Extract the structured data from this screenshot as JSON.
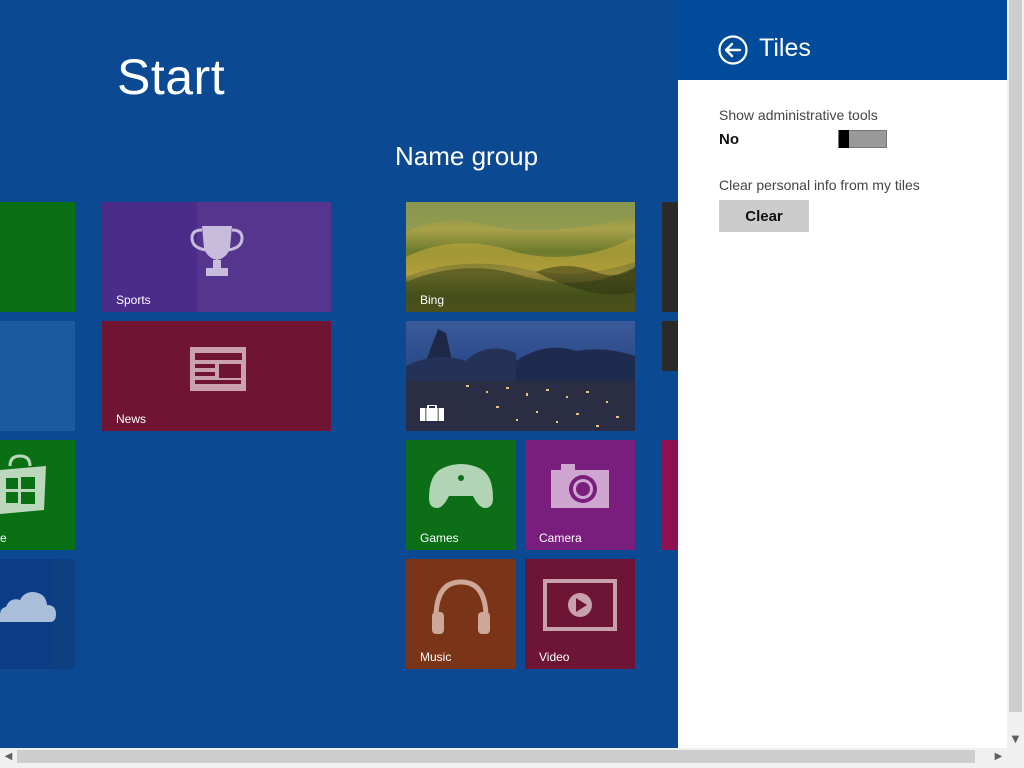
{
  "start": {
    "title": "Start",
    "group_name": "Name group",
    "tiles": {
      "sports": "Sports",
      "news": "News",
      "bing": "Bing",
      "games": "Games",
      "camera": "Camera",
      "music": "Music",
      "video": "Video",
      "store_partial": "e"
    }
  },
  "pane": {
    "title": "Tiles",
    "admin_tools_label": "Show administrative tools",
    "admin_tools_state": "No",
    "clear_info_label": "Clear personal info from my tiles",
    "clear_button": "Clear"
  },
  "colors": {
    "start_bg": "#0b4a92",
    "pane_header": "#004b9a",
    "sports": "#4b2c8a",
    "news": "#6f1432",
    "games": "#0d6e18",
    "camera": "#7a1e7e",
    "music": "#7a3519",
    "video": "#6e1535",
    "green": "#0a6f15"
  }
}
